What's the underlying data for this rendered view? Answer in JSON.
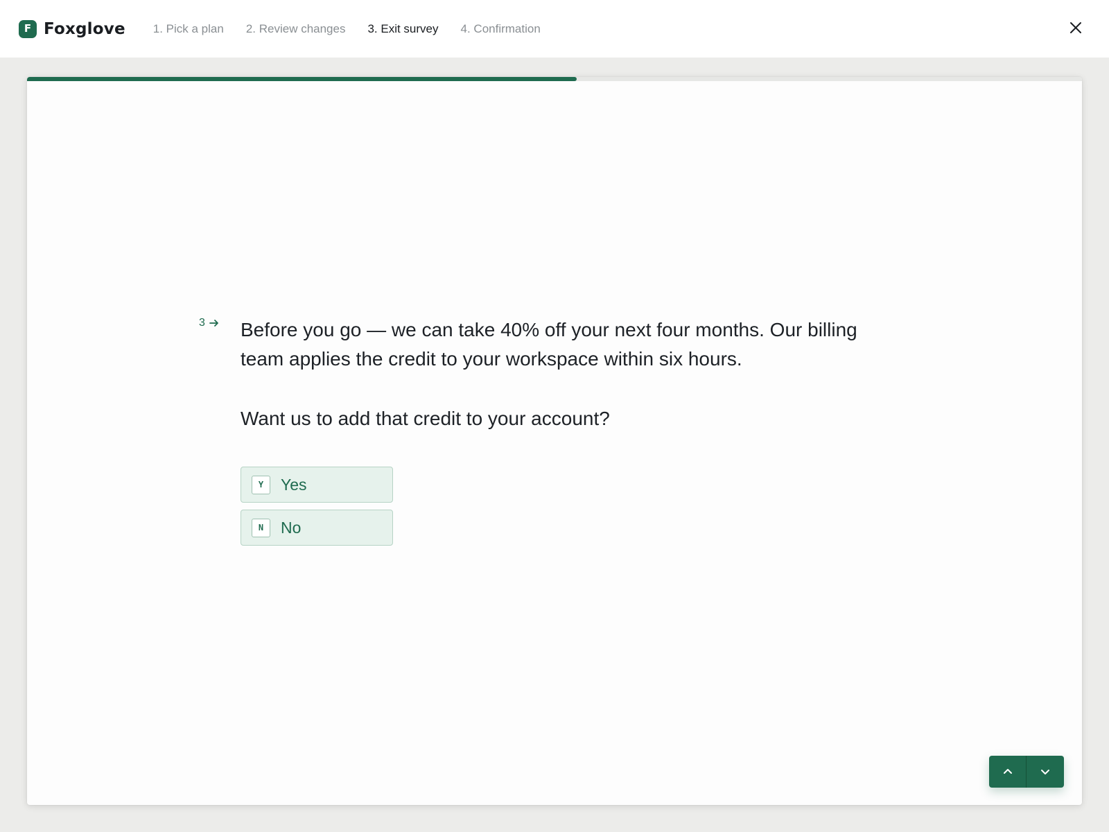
{
  "header": {
    "brand_name": "Foxglove",
    "brand_initial": "F",
    "steps": [
      {
        "label": "1. Pick a plan",
        "active": false
      },
      {
        "label": "2. Review changes",
        "active": false
      },
      {
        "label": "3. Exit survey",
        "active": true
      },
      {
        "label": "4. Confirmation",
        "active": false
      }
    ],
    "close_icon": "close-icon"
  },
  "progress": {
    "fraction": 0.521
  },
  "question": {
    "number": "3",
    "number_icon": "arrow-right-icon",
    "text": "Before you go — we can take 40% off your next four months. Our billing team applies the credit to your workspace within six hours.",
    "subtext": "Want us to add that credit to your account?",
    "choices": [
      {
        "key": "Y",
        "label": "Yes"
      },
      {
        "key": "N",
        "label": "No"
      }
    ]
  },
  "navigation": {
    "up_icon": "chevron-up-icon",
    "down_icon": "chevron-down-icon"
  },
  "colors": {
    "accent": "#1f6b4f",
    "choice_bg": "#e6f2ec",
    "page_bg": "#ececea"
  }
}
